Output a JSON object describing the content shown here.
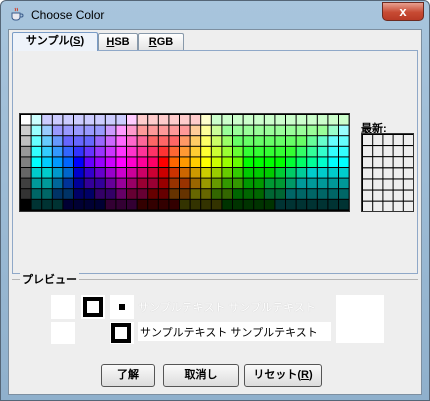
{
  "window": {
    "title": "Choose Color",
    "close_glyph": "x",
    "app_icon": "java-cup-icon",
    "title_color": "#000000",
    "close_color": "#c74a33"
  },
  "tabs": [
    {
      "label": "サンプル(",
      "mnemonic": "S",
      "suffix": ")",
      "active": true
    },
    {
      "label": "",
      "mnemonic": "H",
      "suffix": "SB",
      "active": false
    },
    {
      "label": "",
      "mnemonic": "R",
      "suffix": "GB",
      "active": false
    }
  ],
  "swatches": {
    "recent_label": "最新:",
    "main_colors": [
      [
        "#ffffff",
        "#ccffff",
        "#ccccff",
        "#ccccff",
        "#ccccff",
        "#ccccff",
        "#ccccff",
        "#ccccff",
        "#ccccff",
        "#ccccff",
        "#ffccff",
        "#ffcccc",
        "#ffcccc",
        "#ffcccc",
        "#ffcccc",
        "#ffcccc",
        "#ffcccc",
        "#ffffcc",
        "#ccffcc",
        "#ccffcc",
        "#ccffcc",
        "#ccffcc",
        "#ccffcc",
        "#ccffcc",
        "#ccffcc",
        "#ccffcc",
        "#ccffcc",
        "#ccffcc",
        "#ccffcc",
        "#ccffcc",
        "#ccffcc"
      ],
      [
        "#cccccc",
        "#99ffff",
        "#99ccff",
        "#9999ff",
        "#9999ff",
        "#9999ff",
        "#9999ff",
        "#9999ff",
        "#cc99ff",
        "#ff99ff",
        "#ff99cc",
        "#ff9999",
        "#ff9999",
        "#ff9999",
        "#ff9999",
        "#ff9999",
        "#ffcc99",
        "#ffff99",
        "#ccff99",
        "#99ff99",
        "#99ff99",
        "#99ff99",
        "#99ff99",
        "#99ff99",
        "#99ff99",
        "#99ff99",
        "#99ff99",
        "#99ff99",
        "#99ff99",
        "#99ffcc",
        "#99ffff"
      ],
      [
        "#c0c0c0",
        "#66ffff",
        "#66ccff",
        "#6699ff",
        "#6666ff",
        "#6666ff",
        "#6666ff",
        "#9966ff",
        "#cc66ff",
        "#ff66ff",
        "#ff66cc",
        "#ff6699",
        "#ff6666",
        "#ff6666",
        "#ff6666",
        "#ff9966",
        "#ffcc66",
        "#ffff66",
        "#ccff66",
        "#99ff66",
        "#66ff66",
        "#66ff66",
        "#66ff66",
        "#66ff66",
        "#66ff66",
        "#66ff66",
        "#66ff66",
        "#66ff99",
        "#66ffcc",
        "#66ffff",
        "#66ffff"
      ],
      [
        "#999999",
        "#33ffff",
        "#33ccff",
        "#3399ff",
        "#3366ff",
        "#3333ff",
        "#6633ff",
        "#9933ff",
        "#cc33ff",
        "#ff33ff",
        "#ff33cc",
        "#ff3399",
        "#ff3366",
        "#ff3333",
        "#ff6633",
        "#ff9933",
        "#ffcc33",
        "#ffff33",
        "#ccff33",
        "#99ff33",
        "#66ff33",
        "#33ff33",
        "#33ff33",
        "#33ff33",
        "#33ff33",
        "#33ff33",
        "#33ff66",
        "#33ff99",
        "#33ffcc",
        "#33ffff",
        "#33ffff"
      ],
      [
        "#808080",
        "#00ffff",
        "#00ccff",
        "#0099ff",
        "#0066ff",
        "#0000ff",
        "#6600ff",
        "#9900ff",
        "#cc00ff",
        "#ff00ff",
        "#ff00cc",
        "#ff0099",
        "#ff0066",
        "#ff0000",
        "#ff6600",
        "#ff9900",
        "#ffcc00",
        "#ffff00",
        "#ccff00",
        "#99ff00",
        "#66ff00",
        "#00ff00",
        "#00ff00",
        "#00ff00",
        "#00ff00",
        "#00ff33",
        "#00ff66",
        "#00ff99",
        "#00ffcc",
        "#00ffff",
        "#00ffff"
      ],
      [
        "#666666",
        "#00cccc",
        "#00cccc",
        "#0099cc",
        "#0066cc",
        "#0000cc",
        "#3300cc",
        "#6600cc",
        "#9900cc",
        "#cc00cc",
        "#cc0099",
        "#cc0066",
        "#cc0033",
        "#cc0000",
        "#cc3300",
        "#cc6600",
        "#cc9900",
        "#cccc00",
        "#99cc00",
        "#66cc00",
        "#33cc00",
        "#00cc00",
        "#00cc00",
        "#00cc00",
        "#00cc33",
        "#00cc66",
        "#00cc99",
        "#00cccc",
        "#00cccc",
        "#00cccc",
        "#00cccc"
      ],
      [
        "#404040",
        "#009999",
        "#009999",
        "#006699",
        "#003399",
        "#000099",
        "#330099",
        "#330099",
        "#660099",
        "#990099",
        "#990066",
        "#990033",
        "#990033",
        "#990000",
        "#993300",
        "#993300",
        "#996600",
        "#999900",
        "#669900",
        "#339900",
        "#339900",
        "#009900",
        "#009900",
        "#009933",
        "#009933",
        "#009966",
        "#009999",
        "#009999",
        "#009999",
        "#009999",
        "#009999"
      ],
      [
        "#333333",
        "#006666",
        "#006666",
        "#003366",
        "#003366",
        "#000066",
        "#000066",
        "#330066",
        "#330066",
        "#660066",
        "#660033",
        "#660033",
        "#660000",
        "#660000",
        "#663300",
        "#663300",
        "#666600",
        "#666600",
        "#336600",
        "#336600",
        "#006600",
        "#006600",
        "#006600",
        "#006633",
        "#006633",
        "#006666",
        "#006666",
        "#006666",
        "#006666",
        "#006666",
        "#006666"
      ],
      [
        "#000000",
        "#003333",
        "#003333",
        "#003333",
        "#000033",
        "#000033",
        "#000033",
        "#000033",
        "#330033",
        "#330033",
        "#330033",
        "#330000",
        "#330000",
        "#330000",
        "#330000",
        "#333300",
        "#333300",
        "#333300",
        "#333300",
        "#003300",
        "#003300",
        "#003300",
        "#003300",
        "#003300",
        "#003333",
        "#003333",
        "#003333",
        "#003333",
        "#003333",
        "#003333",
        "#003333"
      ]
    ],
    "recent_rows": 7,
    "recent_cols": 5,
    "recent_color": "#eeeeee"
  },
  "preview": {
    "label": "プレビュー",
    "sample_text": "サンプルテキスト サンプルテキスト",
    "sample_colors": [
      "#ffffff",
      "#000000"
    ]
  },
  "buttons": [
    {
      "label": "了解",
      "mnemonic": "",
      "suffix": ""
    },
    {
      "label": "取消し",
      "mnemonic": "",
      "suffix": ""
    },
    {
      "label": "リセット(",
      "mnemonic": "R",
      "suffix": ")"
    }
  ]
}
